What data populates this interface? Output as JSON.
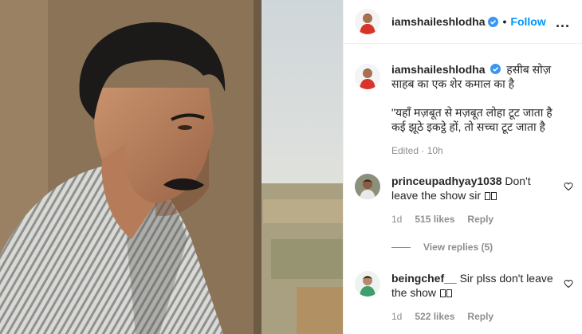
{
  "header": {
    "username": "iamshaileshlodha",
    "separator": "•",
    "follow_label": "Follow",
    "more_label": "..."
  },
  "caption": {
    "username": "iamshaileshlodha",
    "line1": "हसीब सोज़ साहब का एक शेर कमाल का है",
    "quote1": "\"यहाँ मज़बूत से मज़बूत लोहा टूट जाता है",
    "quote2": "कई झूठे इकट्ठे हों, तो सच्चा टूट जाता है",
    "edited": "Edited · 10h"
  },
  "comments": [
    {
      "username": "princeupadhyay1038",
      "text": "Don't leave the show sir",
      "age": "1d",
      "likes": "515 likes",
      "reply_label": "Reply"
    },
    {
      "username": "beingchef__",
      "text": "Sir plss don't leave the show",
      "age": "1d",
      "likes": "522 likes",
      "reply_label": "Reply"
    }
  ],
  "view_replies": "View replies (5)",
  "icons": {
    "verified": "verified-badge-icon",
    "heart": "heart-icon",
    "more": "more-options-icon"
  },
  "colors": {
    "accent": "#0095f6",
    "secondary_text": "#8e8e8e",
    "verified": "#3897f0"
  }
}
